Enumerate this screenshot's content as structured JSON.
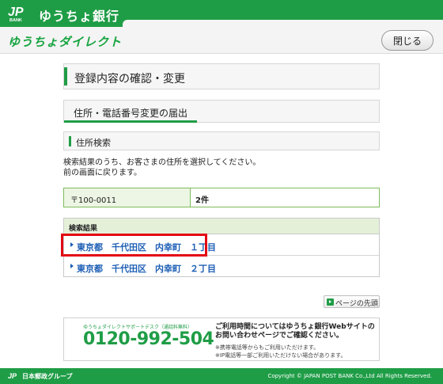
{
  "header": {
    "logo_text": "JP BANK",
    "bank_name": "ゆうちょ銀行",
    "service_name": "ゆうちょダイレクト",
    "close_label": "閉じる"
  },
  "section_titles": {
    "confirm_change": "登録内容の確認・変更",
    "address_change": "住所・電話番号変更の届出",
    "address_search": "住所検索"
  },
  "description": {
    "line1": "検索結果のうち、お客さまの住所を選択してください。",
    "line2": "前の画面に戻ります。"
  },
  "zip_search": {
    "zip": "〒100-0011",
    "count": "2件"
  },
  "results": {
    "header": "検索結果",
    "items": [
      {
        "label": "東京都　千代田区　内幸町　１丁目"
      },
      {
        "label": "東京都　千代田区　内幸町　２丁目"
      }
    ]
  },
  "page_top_label": "ページの先頭",
  "support": {
    "desk_label": "ゆうちょダイレクトサポートデスク（通話料無料）",
    "phone": "0120-992-504",
    "message_line1": "ご利用時間についてはゆうちょ銀行Webサイトの",
    "message_line2": "お問い合わせページでご確認ください。",
    "note1": "※携帯電話等からもご利用いただけます。",
    "note2": "※IP電話等一部ご利用いただけない場合があります。"
  },
  "footer": {
    "group": "日本郵政グループ",
    "copyright": "Copyright © JAPAN POST BANK Co.,Ltd All Rights Reserved."
  },
  "colors": {
    "brand_green": "#1f9d46",
    "link_blue": "#1d5eb5",
    "highlight_red": "#e30613"
  },
  "icons": [
    "jp-bank-logo-icon",
    "arrow-right-icon",
    "page-top-icon"
  ]
}
